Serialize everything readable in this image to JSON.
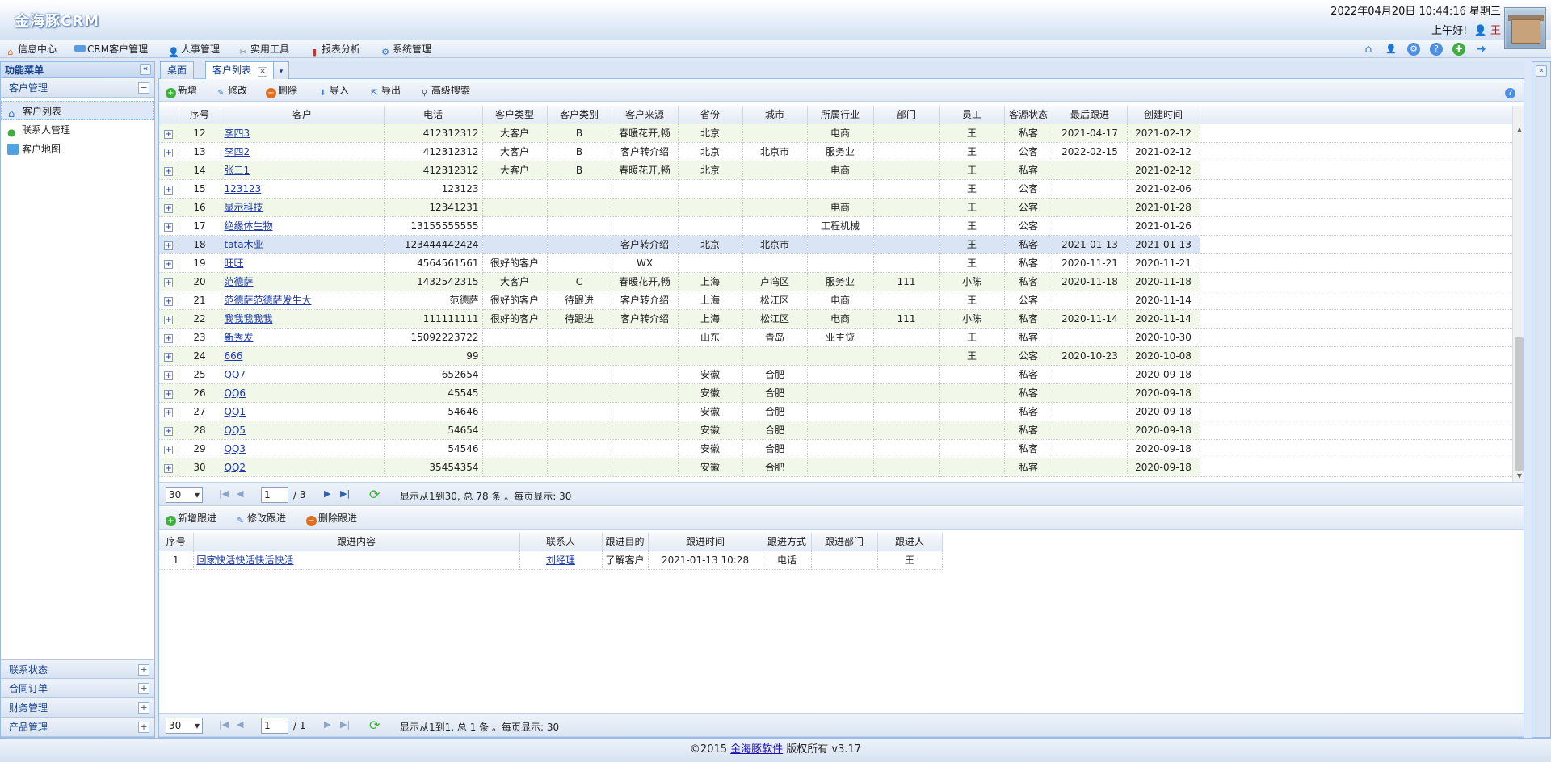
{
  "app": {
    "title": "金海豚CRM"
  },
  "header": {
    "datetime": "2022年04月20日 10:44:16 星期三",
    "greeting": "上午好!",
    "user": "王"
  },
  "nav": [
    {
      "label": "信息中心",
      "icon": "home-icon"
    },
    {
      "label": "CRM客户管理",
      "icon": "card-icon"
    },
    {
      "label": "人事管理",
      "icon": "user-icon"
    },
    {
      "label": "实用工具",
      "icon": "tools-icon"
    },
    {
      "label": "报表分析",
      "icon": "chart-icon"
    },
    {
      "label": "系统管理",
      "icon": "gear-icon"
    }
  ],
  "sidebar": {
    "title": "功能菜单",
    "group": "客户管理",
    "items": [
      {
        "label": "客户列表",
        "icon": "home-icon"
      },
      {
        "label": "联系人管理",
        "icon": "user-icon"
      },
      {
        "label": "客户地图",
        "icon": "map-icon"
      }
    ],
    "bottom_groups": [
      "联系状态",
      "合同订单",
      "财务管理",
      "产品管理"
    ]
  },
  "tabs": [
    {
      "label": "桌面"
    },
    {
      "label": "客户列表"
    }
  ],
  "toolbar": {
    "add": "新增",
    "edit": "修改",
    "delete": "删除",
    "import": "导入",
    "export": "导出",
    "search": "高级搜索"
  },
  "grid": {
    "columns": [
      "序号",
      "客户",
      "电话",
      "客户类型",
      "客户类别",
      "客户来源",
      "省份",
      "城市",
      "所属行业",
      "部门",
      "员工",
      "客源状态",
      "最后跟进",
      "创建时间"
    ],
    "rows": [
      [
        "12",
        "李四3",
        "412312312",
        "大客户",
        "B",
        "春暖花开,畅",
        "北京",
        "",
        "电商",
        "",
        "王",
        "私客",
        "2021-04-17",
        "2021-02-12"
      ],
      [
        "13",
        "李四2",
        "412312312",
        "大客户",
        "B",
        "客户转介绍",
        "北京",
        "北京市",
        "服务业",
        "",
        "王",
        "公客",
        "2022-02-15",
        "2021-02-12"
      ],
      [
        "14",
        "张三1",
        "412312312",
        "大客户",
        "B",
        "春暖花开,畅",
        "北京",
        "",
        "电商",
        "",
        "王",
        "私客",
        "",
        "2021-02-12"
      ],
      [
        "15",
        "123123",
        "123123",
        "",
        "",
        "",
        "",
        "",
        "",
        "",
        "王",
        "公客",
        "",
        "2021-02-06"
      ],
      [
        "16",
        "显示科技",
        "12341231",
        "",
        "",
        "",
        "",
        "",
        "电商",
        "",
        "王",
        "公客",
        "",
        "2021-01-28"
      ],
      [
        "17",
        "绝缘体生物",
        "13155555555",
        "",
        "",
        "",
        "",
        "",
        "工程机械",
        "",
        "王",
        "公客",
        "",
        "2021-01-26"
      ],
      [
        "18",
        "tata木业",
        "123444442424",
        "",
        "",
        "客户转介绍",
        "北京",
        "北京市",
        "",
        "",
        "王",
        "私客",
        "2021-01-13",
        "2021-01-13"
      ],
      [
        "19",
        "旺旺",
        "4564561561",
        "很好的客户",
        "",
        "WX",
        "",
        "",
        "",
        "",
        "王",
        "私客",
        "2020-11-21",
        "2020-11-21"
      ],
      [
        "20",
        "范德萨",
        "1432542315",
        "大客户",
        "C",
        "春暖花开,畅",
        "上海",
        "卢湾区",
        "服务业",
        "111",
        "小陈",
        "私客",
        "2020-11-18",
        "2020-11-18"
      ],
      [
        "21",
        "范德萨范德萨发生大",
        "范德萨",
        "很好的客户",
        "待跟进",
        "客户转介绍",
        "上海",
        "松江区",
        "电商",
        "",
        "王",
        "公客",
        "",
        "2020-11-14"
      ],
      [
        "22",
        "我我我我我",
        "111111111",
        "很好的客户",
        "待跟进",
        "客户转介绍",
        "上海",
        "松江区",
        "电商",
        "111",
        "小陈",
        "私客",
        "2020-11-14",
        "2020-11-14"
      ],
      [
        "23",
        "新秀发",
        "15092223722",
        "",
        "",
        "",
        "山东",
        "青岛",
        "业主贷",
        "",
        "王",
        "私客",
        "",
        "2020-10-30"
      ],
      [
        "24",
        "666",
        "99",
        "",
        "",
        "",
        "",
        "",
        "",
        "",
        "王",
        "公客",
        "2020-10-23",
        "2020-10-08"
      ],
      [
        "25",
        "QQ7",
        "652654",
        "",
        "",
        "",
        "安徽",
        "合肥",
        "",
        "",
        "",
        "私客",
        "",
        "2020-09-18"
      ],
      [
        "26",
        "QQ6",
        "45545",
        "",
        "",
        "",
        "安徽",
        "合肥",
        "",
        "",
        "",
        "私客",
        "",
        "2020-09-18"
      ],
      [
        "27",
        "QQ1",
        "54646",
        "",
        "",
        "",
        "安徽",
        "合肥",
        "",
        "",
        "",
        "私客",
        "",
        "2020-09-18"
      ],
      [
        "28",
        "QQ5",
        "54654",
        "",
        "",
        "",
        "安徽",
        "合肥",
        "",
        "",
        "",
        "私客",
        "",
        "2020-09-18"
      ],
      [
        "29",
        "QQ3",
        "54546",
        "",
        "",
        "",
        "安徽",
        "合肥",
        "",
        "",
        "",
        "私客",
        "",
        "2020-09-18"
      ],
      [
        "30",
        "QQ2",
        "35454354",
        "",
        "",
        "",
        "安徽",
        "合肥",
        "",
        "",
        "",
        "私客",
        "",
        "2020-09-18"
      ]
    ],
    "selected_row": 6
  },
  "pager1": {
    "page_size": "30",
    "page": "1",
    "total_pages": "/ 3",
    "info": "显示从1到30, 总 78 条 。每页显示: 30"
  },
  "follow_toolbar": {
    "add": "新增跟进",
    "edit": "修改跟进",
    "delete": "删除跟进"
  },
  "follow_grid": {
    "columns": [
      "序号",
      "跟进内容",
      "联系人",
      "跟进目的",
      "跟进时间",
      "跟进方式",
      "跟进部门",
      "跟进人"
    ],
    "rows": [
      [
        "1",
        "回家快活快活快活快活",
        "刘经理",
        "了解客户",
        "2021-01-13 10:28",
        "电话",
        "",
        "王"
      ]
    ]
  },
  "pager2": {
    "page_size": "30",
    "page": "1",
    "total_pages": "/ 1",
    "info": "显示从1到1, 总 1 条 。每页显示: 30"
  },
  "footer": {
    "prefix": "©2015 ",
    "link": "金海豚软件",
    "suffix": " 版权所有 v3.17"
  },
  "colors": {
    "accent": "#99bbe8",
    "alt_row": "#f1f8e9",
    "selected_row": "#d9e5f4",
    "link": "#1b38a8"
  }
}
